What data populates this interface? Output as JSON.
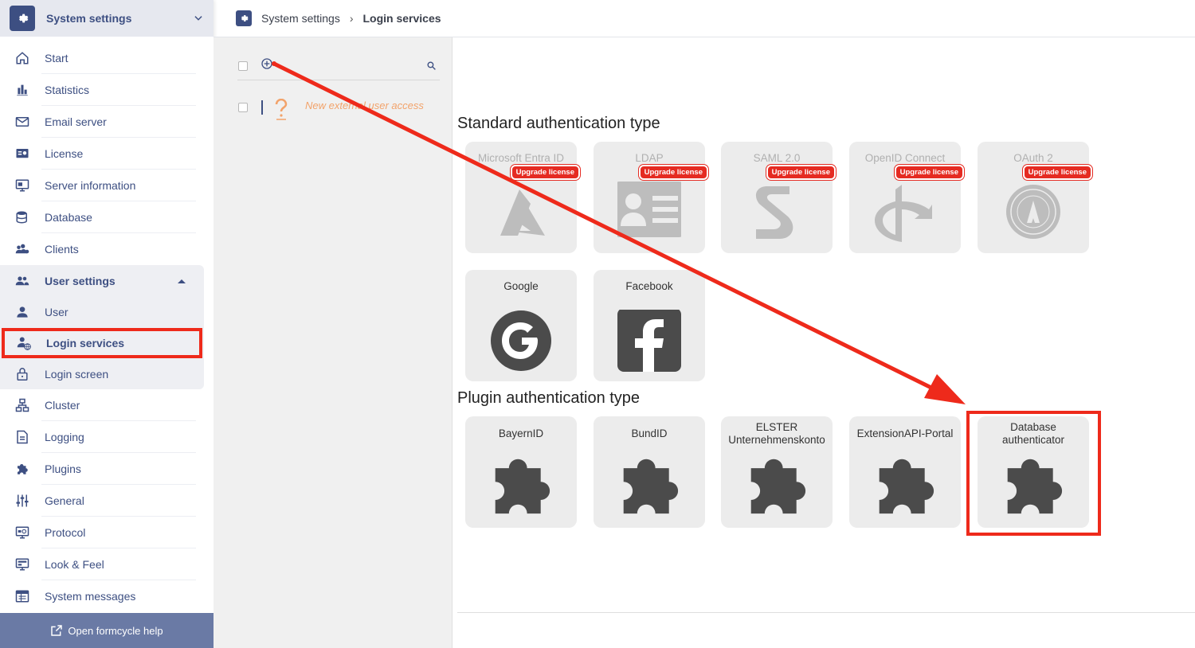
{
  "app": {
    "title": "System settings"
  },
  "sidebar": {
    "items": [
      {
        "label": "Start",
        "icon": "home-icon"
      },
      {
        "label": "Statistics",
        "icon": "bar-chart-icon"
      },
      {
        "label": "Email server",
        "icon": "mail-icon"
      },
      {
        "label": "License",
        "icon": "license-icon"
      },
      {
        "label": "Server information",
        "icon": "monitor-info-icon"
      },
      {
        "label": "Database",
        "icon": "database-icon"
      },
      {
        "label": "Clients",
        "icon": "clients-icon"
      }
    ],
    "user_settings": {
      "label": "User settings",
      "items": [
        {
          "label": "User"
        },
        {
          "label": "Login services"
        },
        {
          "label": "Login screen"
        }
      ]
    },
    "items2": [
      {
        "label": "Cluster",
        "icon": "cluster-icon"
      },
      {
        "label": "Logging",
        "icon": "logging-icon"
      },
      {
        "label": "Plugins",
        "icon": "puzzle-icon"
      },
      {
        "label": "General",
        "icon": "sliders-icon"
      },
      {
        "label": "Protocol",
        "icon": "protocol-icon"
      },
      {
        "label": "Look & Feel",
        "icon": "look-feel-icon"
      },
      {
        "label": "System messages",
        "icon": "messages-icon"
      }
    ],
    "footer": "Open formcycle help"
  },
  "breadcrumb": {
    "root": "System settings",
    "current": "Login services"
  },
  "list": {
    "item_text": "New external user access"
  },
  "sections": {
    "standard": "Standard authentication type",
    "plugin": "Plugin authentication type"
  },
  "badge_label": "Upgrade license",
  "standard_tiles": [
    {
      "name": "Microsoft Entra ID",
      "icon": "azure-icon"
    },
    {
      "name": "LDAP",
      "icon": "id-card-icon"
    },
    {
      "name": "SAML 2.0",
      "icon": "saml-icon"
    },
    {
      "name": "OpenID Connect",
      "icon": "openid-icon"
    },
    {
      "name": "OAuth 2",
      "icon": "oauth-icon"
    }
  ],
  "social_tiles": [
    {
      "name": "Google",
      "icon": "google-icon"
    },
    {
      "name": "Facebook",
      "icon": "facebook-icon"
    }
  ],
  "plugin_tiles": [
    {
      "name": "BayernID",
      "icon": "puzzle-icon"
    },
    {
      "name": "BundID",
      "icon": "puzzle-icon"
    },
    {
      "name": "ELSTER Unternehmenskonto",
      "icon": "puzzle-icon"
    },
    {
      "name": "ExtensionAPI-Portal",
      "icon": "puzzle-icon"
    },
    {
      "name": "Database authenticator",
      "icon": "puzzle-icon"
    }
  ],
  "colors": {
    "accent": "#3d4f82",
    "highlight": "#ee2a1b",
    "badge": "#e52b22",
    "tile": "#ececec"
  }
}
